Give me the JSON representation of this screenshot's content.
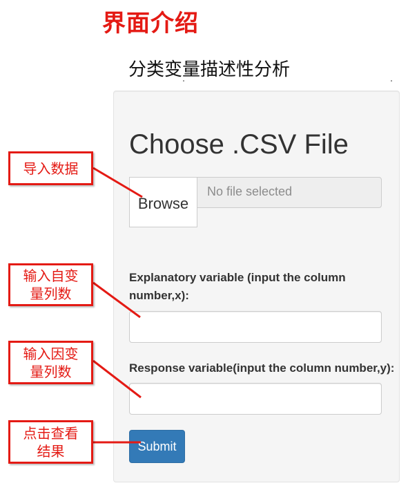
{
  "page": {
    "title": "界面介绍"
  },
  "app": {
    "title": "分类变量描述性分析"
  },
  "upload": {
    "heading": "Choose .CSV File",
    "browse_label": "Browse",
    "file_status": "No file selected"
  },
  "explanatory": {
    "label": "Explanatory variable (input the column number,x):",
    "value": ""
  },
  "response": {
    "label": "Response variable(input the column number,y):",
    "value": ""
  },
  "submit": {
    "label": "Submit"
  },
  "annotations": [
    {
      "text": "导入数据"
    },
    {
      "text": "输入自变量列数"
    },
    {
      "text": "输入因变量列数"
    },
    {
      "text": "点击查看结果"
    }
  ],
  "colors": {
    "annotation": "#e41a14",
    "primary_button": "#337ab7",
    "panel_background": "#f5f5f5"
  }
}
